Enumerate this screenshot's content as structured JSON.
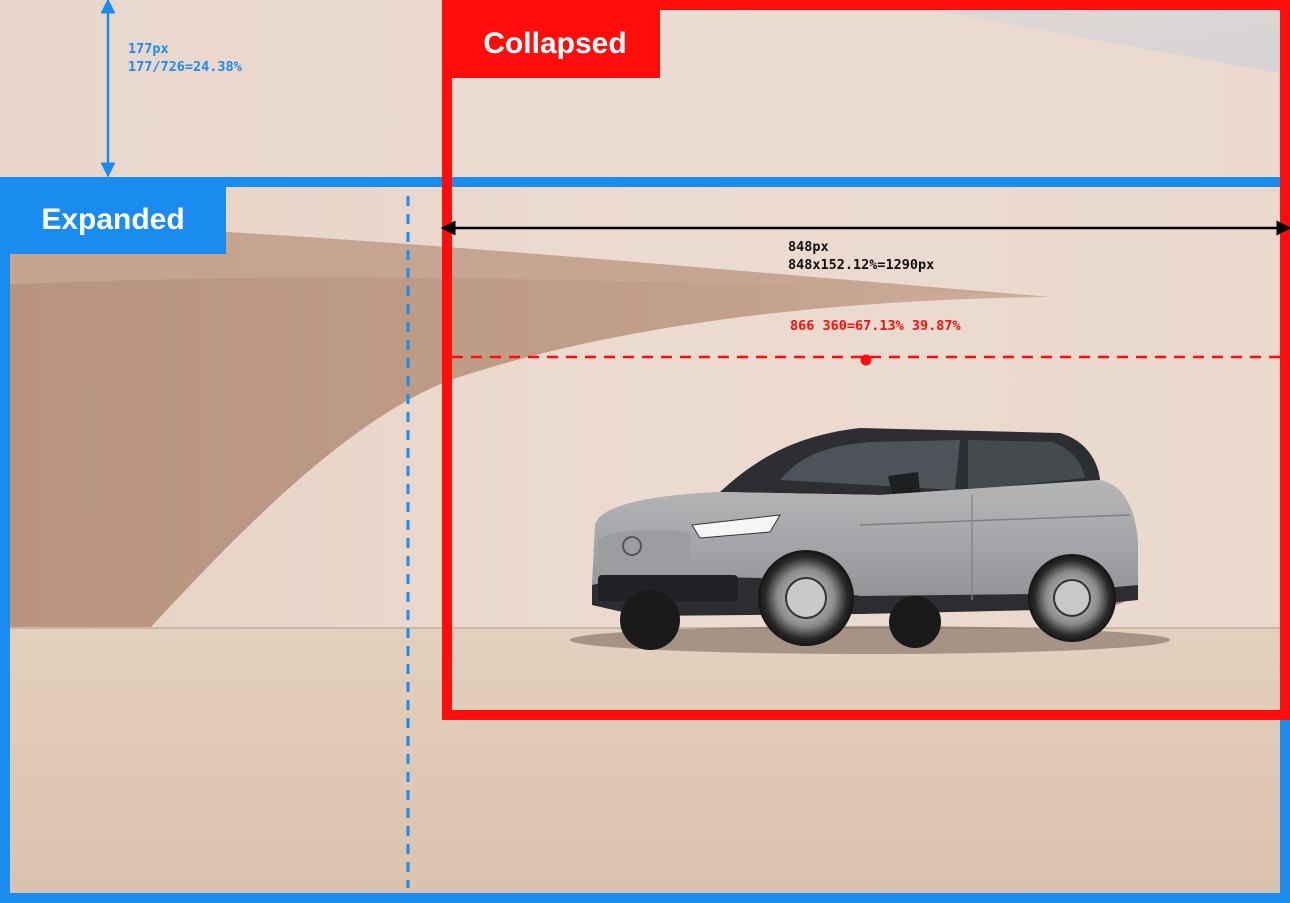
{
  "frames": {
    "expanded": {
      "label": "Expanded",
      "color": "#1a8cf0"
    },
    "collapsed": {
      "label": "Collapsed",
      "color": "#ff0c0c"
    }
  },
  "measurements": {
    "top_offset": {
      "line1": "177px",
      "line2": "177/726=24.38%"
    },
    "collapsed_width": {
      "line1": "848px",
      "line2": "848x152.12%=1290px"
    },
    "focal_point": {
      "label": "866 360=67.13% 39.87%"
    }
  },
  "photo": {
    "subject": "grey electric SUV parked in front of a curved beige wall",
    "icons": [
      "car-image",
      "focal-point-dot"
    ]
  }
}
